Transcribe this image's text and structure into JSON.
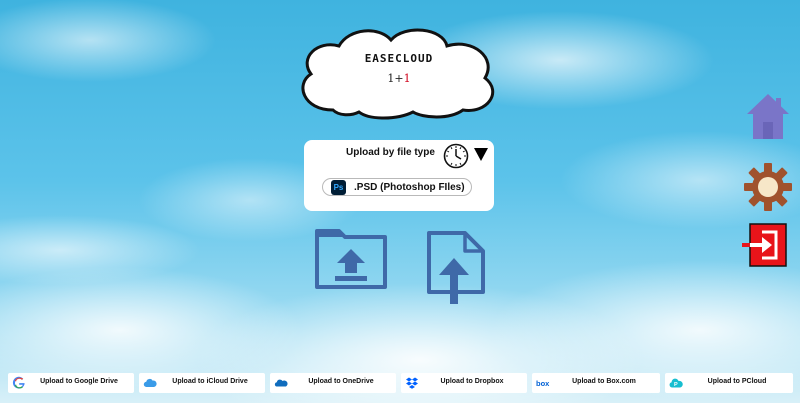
{
  "app": {
    "name": "EASECLOUD",
    "version_prefix": "1+",
    "version_suffix": "1"
  },
  "type_panel": {
    "label": "Upload by file type",
    "selected_type": ".PSD (Photoshop FIles)",
    "selected_badge": "Ps"
  },
  "actions": {
    "upload_folder": "folder-upload-icon",
    "upload_file": "file-upload-icon"
  },
  "side_nav": [
    "home-icon",
    "gear-icon",
    "exit-icon"
  ],
  "upload_targets": [
    {
      "label": "Upload to Google Drive",
      "icon": "google-icon"
    },
    {
      "label": "Upload to iCloud Drive",
      "icon": "icloud-icon"
    },
    {
      "label": "Upload to OneDrive",
      "icon": "onedrive-icon"
    },
    {
      "label": "Upload to Dropbox",
      "icon": "dropbox-icon"
    },
    {
      "label": "Upload to Box.com",
      "icon": "box-icon"
    },
    {
      "label": "Upload to PCloud",
      "icon": "pcloud-icon"
    }
  ],
  "colors": {
    "icon_blue": "#3f69a8",
    "home_purple": "#7a75c8",
    "gear_brown": "#a0522d",
    "exit_red": "#e8141a"
  }
}
